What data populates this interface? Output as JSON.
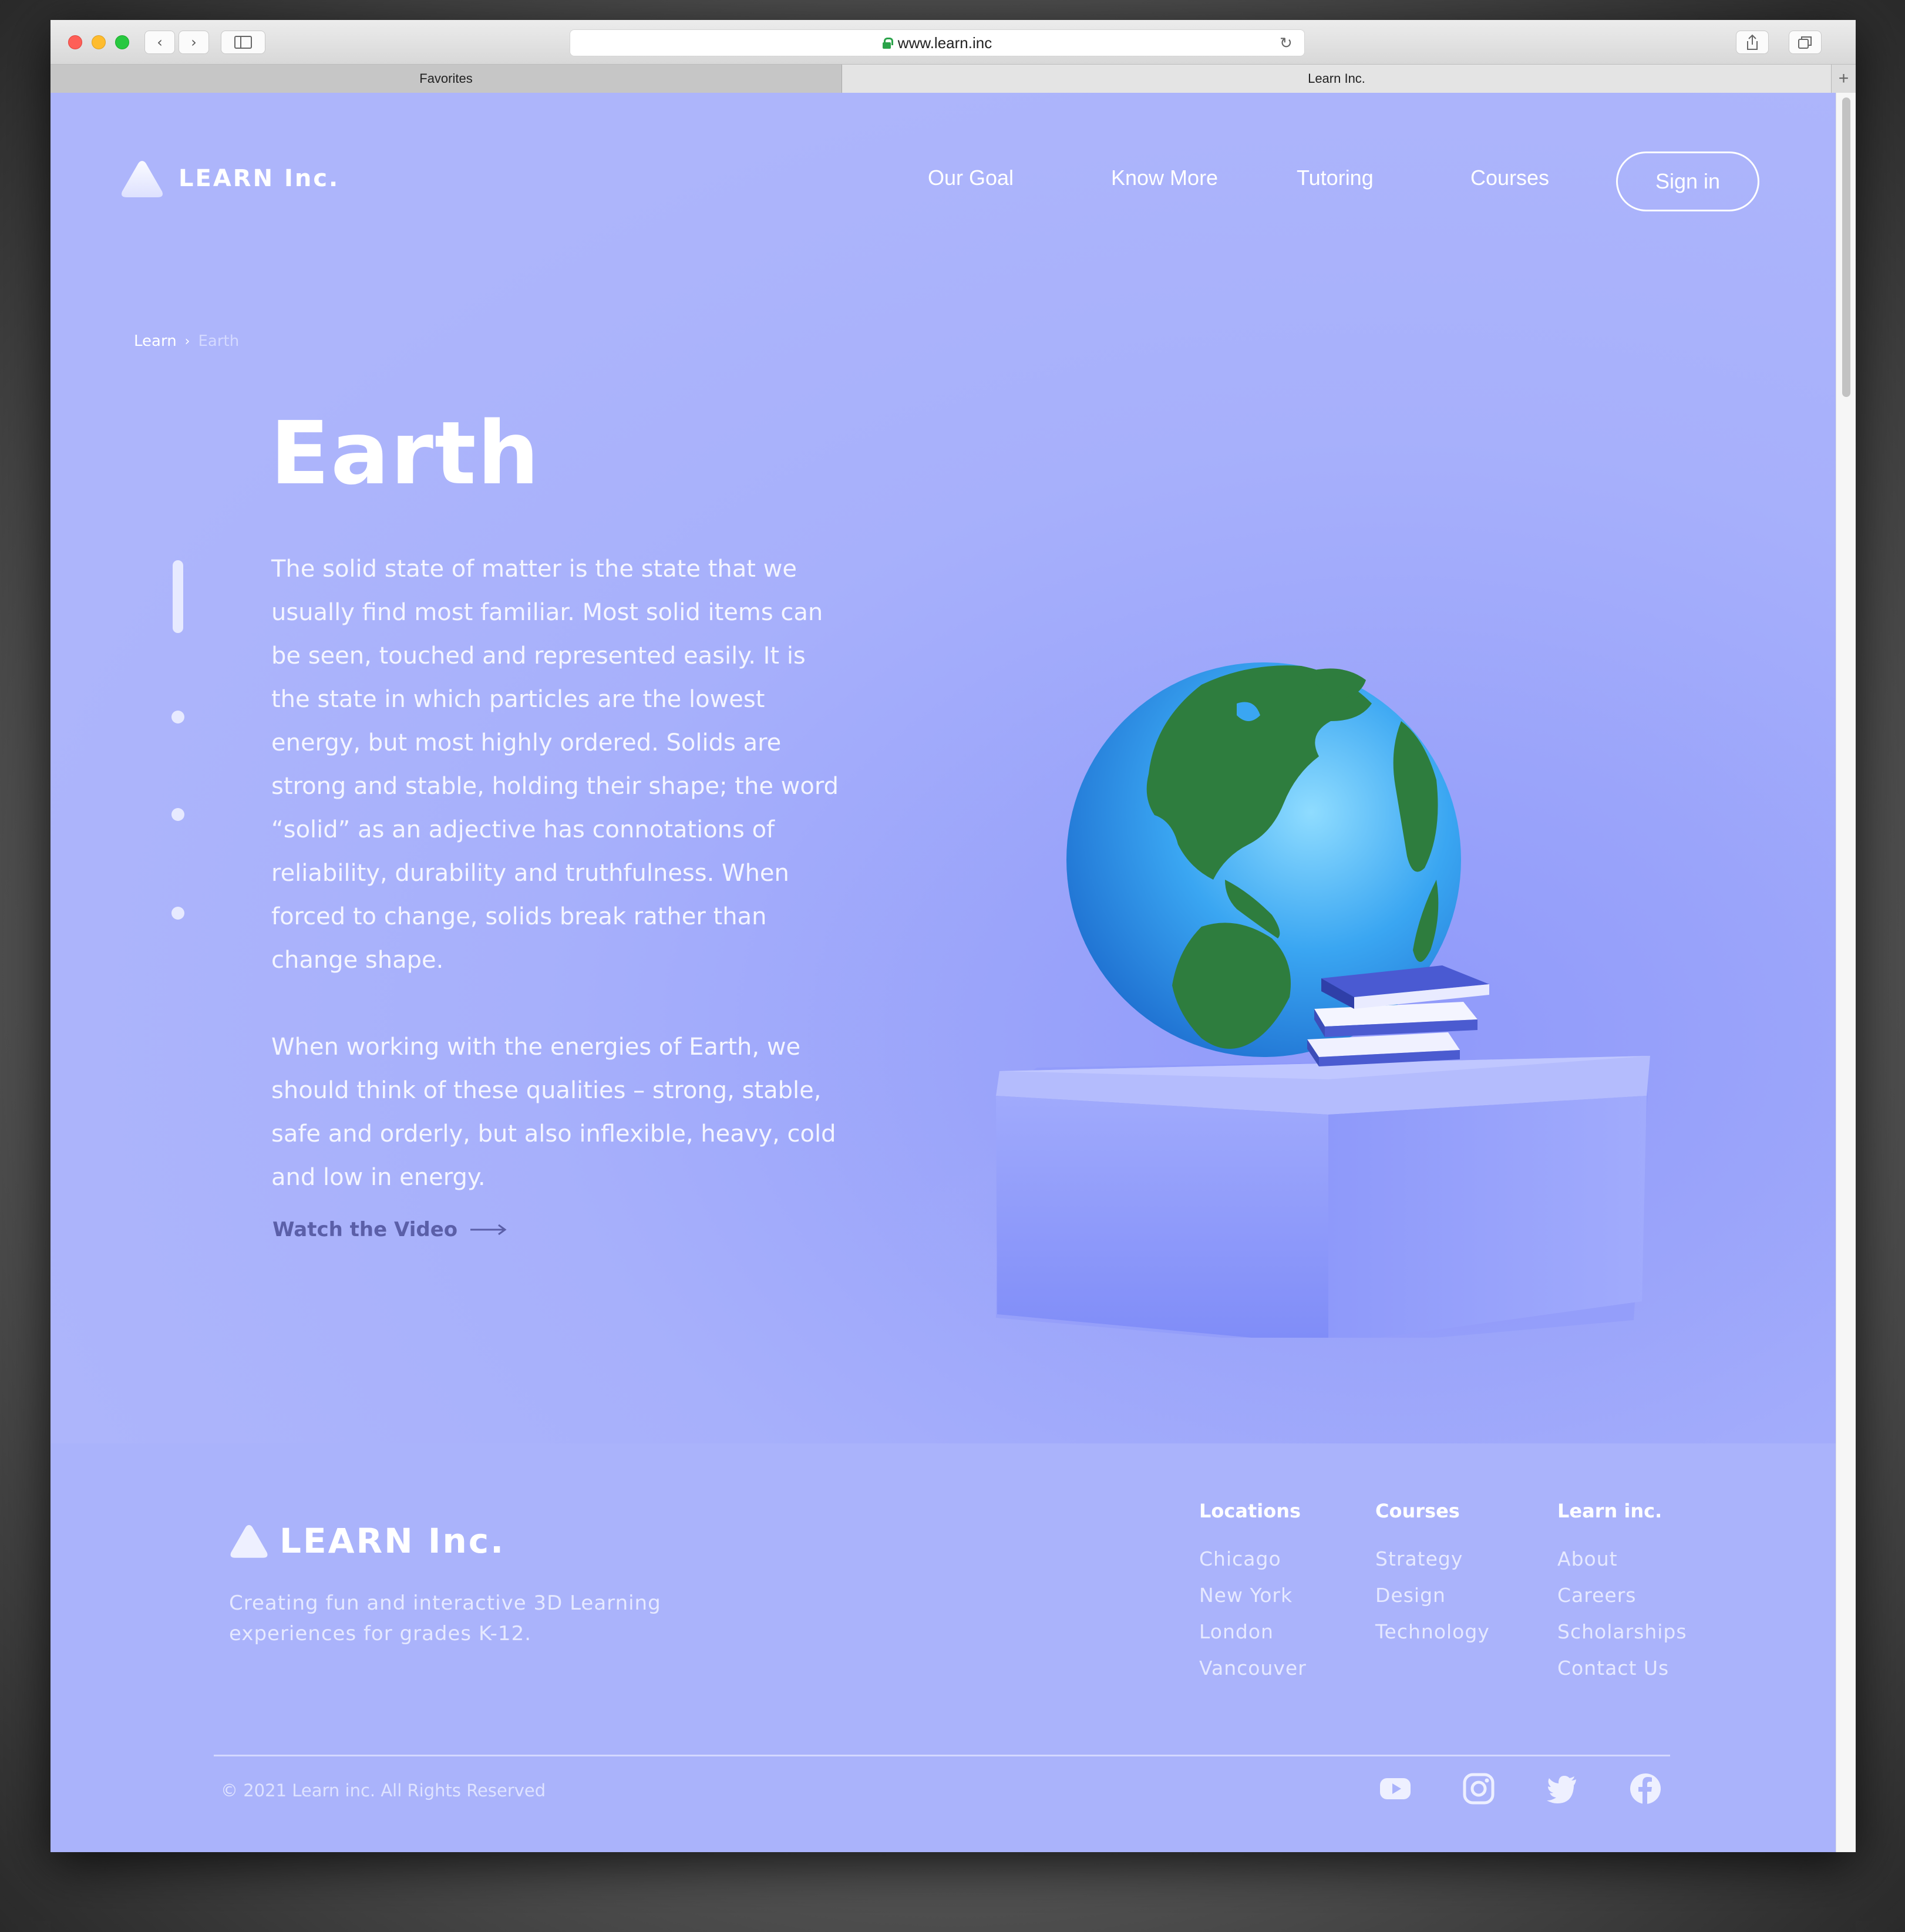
{
  "browser": {
    "url": "www.learn.inc",
    "tabs": [
      {
        "label": "Favorites"
      },
      {
        "label": "Learn Inc."
      }
    ],
    "add_tab_label": "+"
  },
  "header": {
    "logo_text": "LEARN Inc.",
    "nav": [
      {
        "label": "Our Goal"
      },
      {
        "label": "Know More"
      },
      {
        "label": "Tutoring"
      },
      {
        "label": "Courses"
      }
    ],
    "signin_label": "Sign in"
  },
  "breadcrumb": {
    "root": "Learn",
    "current": "Earth"
  },
  "hero": {
    "title": "Earth",
    "paragraph_1": "The solid state of matter is the state that we usually find most familiar. Most solid items can be seen, touched and represented easily. It is the state in which particles are the lowest energy, but most highly ordered. Solids are strong and stable, holding their shape; the word “solid” as an adjective has connotations of reliability, durability and truthfulness. When forced to change, solids break rather than change shape.",
    "paragraph_2": "When working with the energies of Earth, we should think of these qualities – strong, stable, safe and orderly, but also inflexible, heavy, cold and low in energy.",
    "watch_label": "Watch the Video"
  },
  "footer": {
    "logo_text": "LEARN Inc.",
    "tagline": "Creating fun and interactive 3D Learning  experiences for grades K-12.",
    "columns": [
      {
        "heading": "Locations",
        "links": [
          "Chicago",
          "New York",
          "London",
          "Vancouver"
        ]
      },
      {
        "heading": "Courses",
        "links": [
          "Strategy",
          "Design",
          "Technology"
        ]
      },
      {
        "heading": "Learn inc.",
        "links": [
          "About",
          "Careers",
          "Scholarships",
          "Contact Us"
        ]
      }
    ],
    "copyright": "© 2021 Learn inc. All Rights Reserved",
    "social_icons": [
      "youtube-icon",
      "instagram-icon",
      "twitter-icon",
      "facebook-icon"
    ]
  },
  "colors": {
    "page_background": "#aab3fb",
    "accent_text": "#5b5fa8",
    "globe_ocean": "#3aa6f2",
    "globe_land": "#2e7d3e"
  }
}
